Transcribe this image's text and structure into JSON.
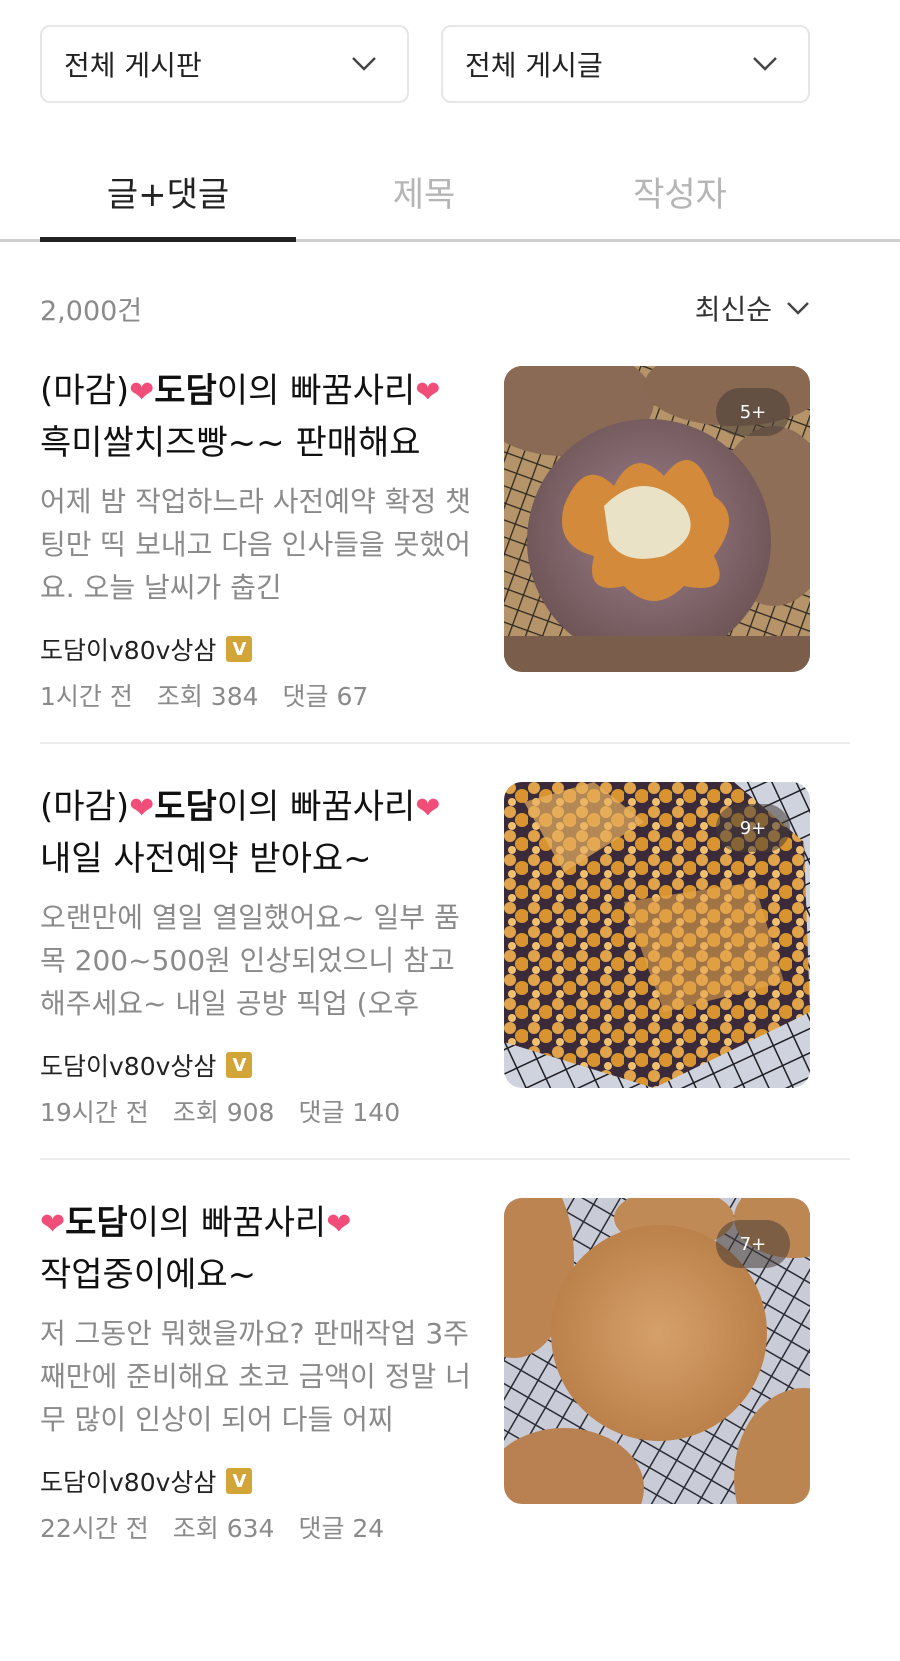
{
  "filters": {
    "board_select": "전체 게시판",
    "post_select": "전체 게시글"
  },
  "tabs": [
    {
      "label": "글+댓글",
      "active": true
    },
    {
      "label": "제목",
      "active": false
    },
    {
      "label": "작성자",
      "active": false
    }
  ],
  "results": {
    "count": "2,000건",
    "sort": "최신순"
  },
  "posts": [
    {
      "title_prefix": "(마감)",
      "title_bold": "도담",
      "title_rest": "이의 빠꿈사리",
      "title_line2": "흑미쌀치즈빵~~ 판매해요",
      "excerpt": "어제 밤 작업하느라 사전예약 확정 챗팅만 띡 보내고 다음 인사들을 못했어요. 오늘 날씨가 춥긴",
      "author": "도담이v80v상삼",
      "badge": "V",
      "time": "1시간 전",
      "views": "조회 384",
      "comments": "댓글 67",
      "image_count": "5+"
    },
    {
      "title_prefix": "(마감)",
      "title_bold": "도담",
      "title_rest": "이의 빠꿈사리",
      "title_line2": "내일 사전예약 받아요~",
      "excerpt": "오랜만에 열일 열일했어요~ 일부 품목 200~500원 인상되었으니 참고해주세요~ 내일 공방 픽업 (오후",
      "author": "도담이v80v상삼",
      "badge": "V",
      "time": "19시간 전",
      "views": "조회 908",
      "comments": "댓글 140",
      "image_count": "9+"
    },
    {
      "title_prefix": "",
      "title_bold": "도담",
      "title_rest": "이의 빠꿈사리",
      "title_line2": "작업중이에요~",
      "excerpt": "저 그동안 뭐했을까요? 판매작업 3주째만에 준비해요 초코 금액이 정말 너무 많이 인상이 되어 다들 어찌",
      "author": "도담이v80v상삼",
      "badge": "V",
      "time": "22시간 전",
      "views": "조회 634",
      "comments": "댓글 24",
      "image_count": "7+"
    }
  ],
  "icons": {
    "dropdown": "chevron-down-icon",
    "heart": "heart-balloon-icon",
    "verified": "verified-badge-icon"
  },
  "colors": {
    "heart": "#f04d78",
    "badge": "#d3a437",
    "muted": "#8a8a8a"
  }
}
